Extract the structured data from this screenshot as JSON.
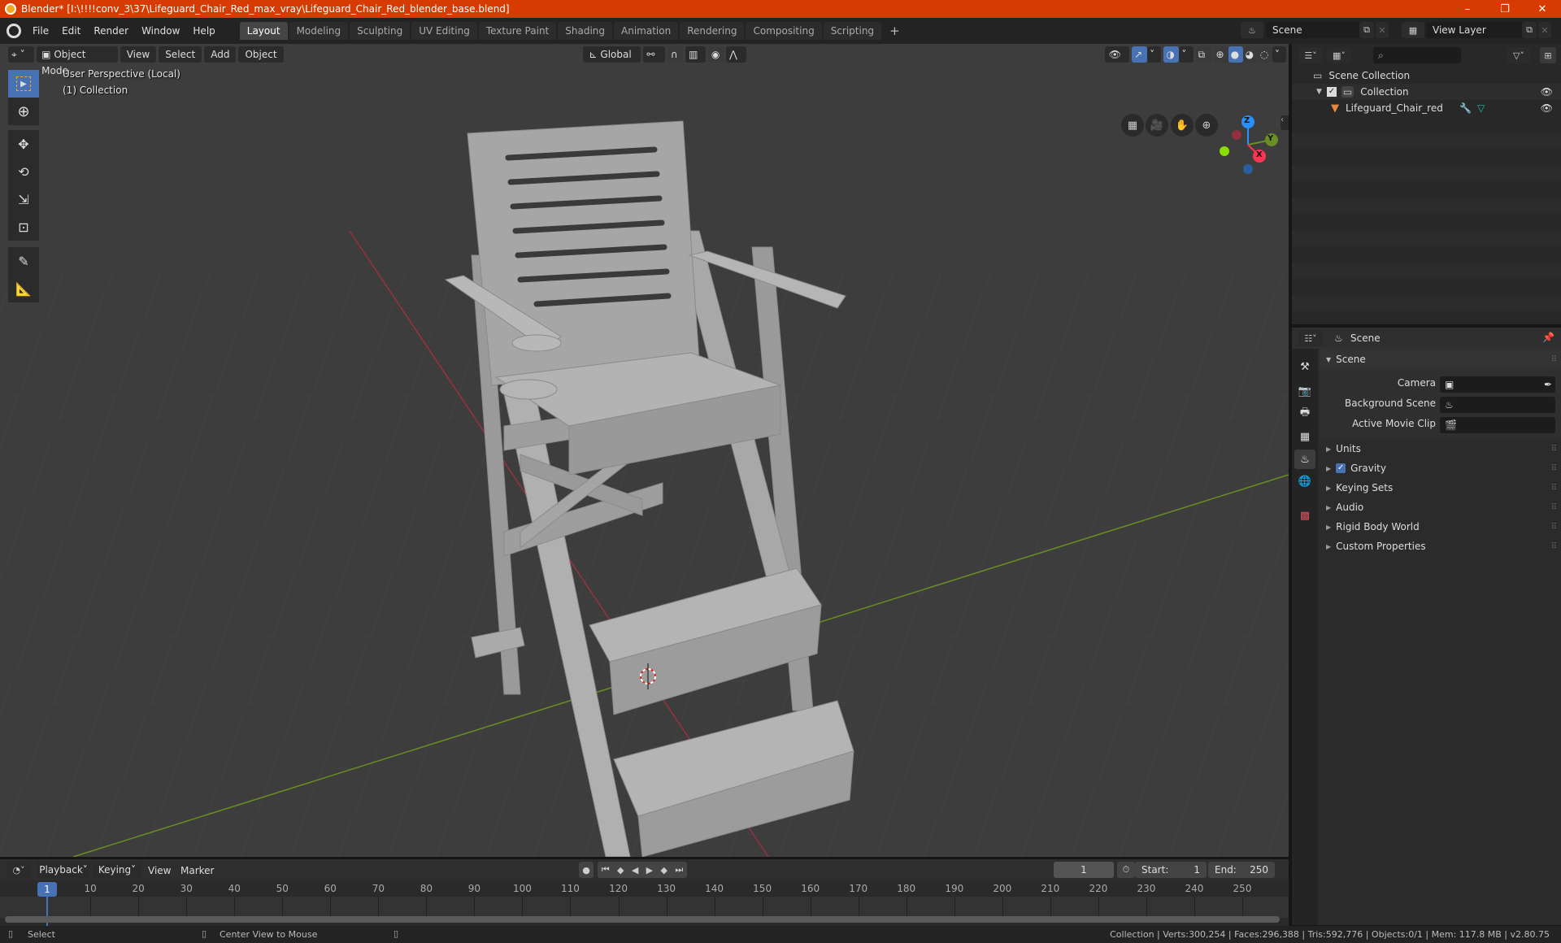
{
  "window": {
    "title": "Blender* [I:\\!!!!conv_3\\37\\Lifeguard_Chair_Red_max_vray\\Lifeguard_Chair_Red_blender_base.blend]",
    "controls": {
      "minimize": "–",
      "maximize": "❐",
      "close": "✕"
    },
    "accent_color": "#d83b01"
  },
  "menu": {
    "items": [
      "File",
      "Edit",
      "Render",
      "Window",
      "Help"
    ]
  },
  "workspaces": {
    "tabs": [
      "Layout",
      "Modeling",
      "Sculpting",
      "UV Editing",
      "Texture Paint",
      "Shading",
      "Animation",
      "Rendering",
      "Compositing",
      "Scripting"
    ],
    "active": "Layout",
    "add_label": "+"
  },
  "scene_selector": {
    "value": "Scene"
  },
  "view_layer_selector": {
    "value": "View Layer"
  },
  "viewport": {
    "mode": "Object Mode",
    "menus": [
      "View",
      "Select",
      "Add",
      "Object"
    ],
    "transform_orientation": "Global",
    "overlay_text": {
      "line1": "User Perspective (Local)",
      "line2": "(1) Collection"
    },
    "tools": [
      "select-box",
      "cursor",
      "move",
      "rotate",
      "scale",
      "transform",
      "annotate",
      "measure"
    ],
    "gizmo_axes": {
      "x": "X",
      "y": "Y",
      "z": "Z"
    },
    "axis_colors": {
      "x": "#ff3352",
      "y": "#8bdc00",
      "z": "#2890ff"
    },
    "shading_active": "solid"
  },
  "outliner": {
    "search_placeholder": "",
    "rows": [
      {
        "label": "Scene Collection",
        "type": "scene-collection"
      },
      {
        "label": "Collection",
        "type": "collection",
        "checked": true,
        "visible": true
      },
      {
        "label": "Lifeguard_Chair_red",
        "type": "mesh-object",
        "visible": true
      }
    ]
  },
  "properties": {
    "context": "Scene",
    "panel_title": "Scene",
    "fields": [
      {
        "label": "Camera",
        "value": ""
      },
      {
        "label": "Background Scene",
        "value": ""
      },
      {
        "label": "Active Movie Clip",
        "value": ""
      }
    ],
    "subpanels": [
      {
        "label": "Units"
      },
      {
        "label": "Gravity",
        "checkbox": true,
        "checked": true
      },
      {
        "label": "Keying Sets"
      },
      {
        "label": "Audio"
      },
      {
        "label": "Rigid Body World"
      },
      {
        "label": "Custom Properties"
      }
    ]
  },
  "timeline": {
    "menus": [
      "Playback",
      "Keying",
      "View",
      "Marker"
    ],
    "current_frame": "1",
    "start_label": "Start:",
    "start": "1",
    "end_label": "End:",
    "end": "250",
    "ticks": [
      "10",
      "20",
      "30",
      "40",
      "50",
      "60",
      "70",
      "80",
      "90",
      "100",
      "110",
      "120",
      "130",
      "140",
      "150",
      "160",
      "170",
      "180",
      "190",
      "200",
      "210",
      "220",
      "230",
      "240",
      "250"
    ],
    "playhead_frame": "1"
  },
  "statusbar": {
    "left": [
      {
        "label": "Select"
      },
      {
        "label": "Center View to Mouse"
      }
    ],
    "stats": "Collection | Verts:300,254 | Faces:296,388 | Tris:592,776 | Objects:0/1 | Mem: 117.8 MB | v2.80.75"
  }
}
